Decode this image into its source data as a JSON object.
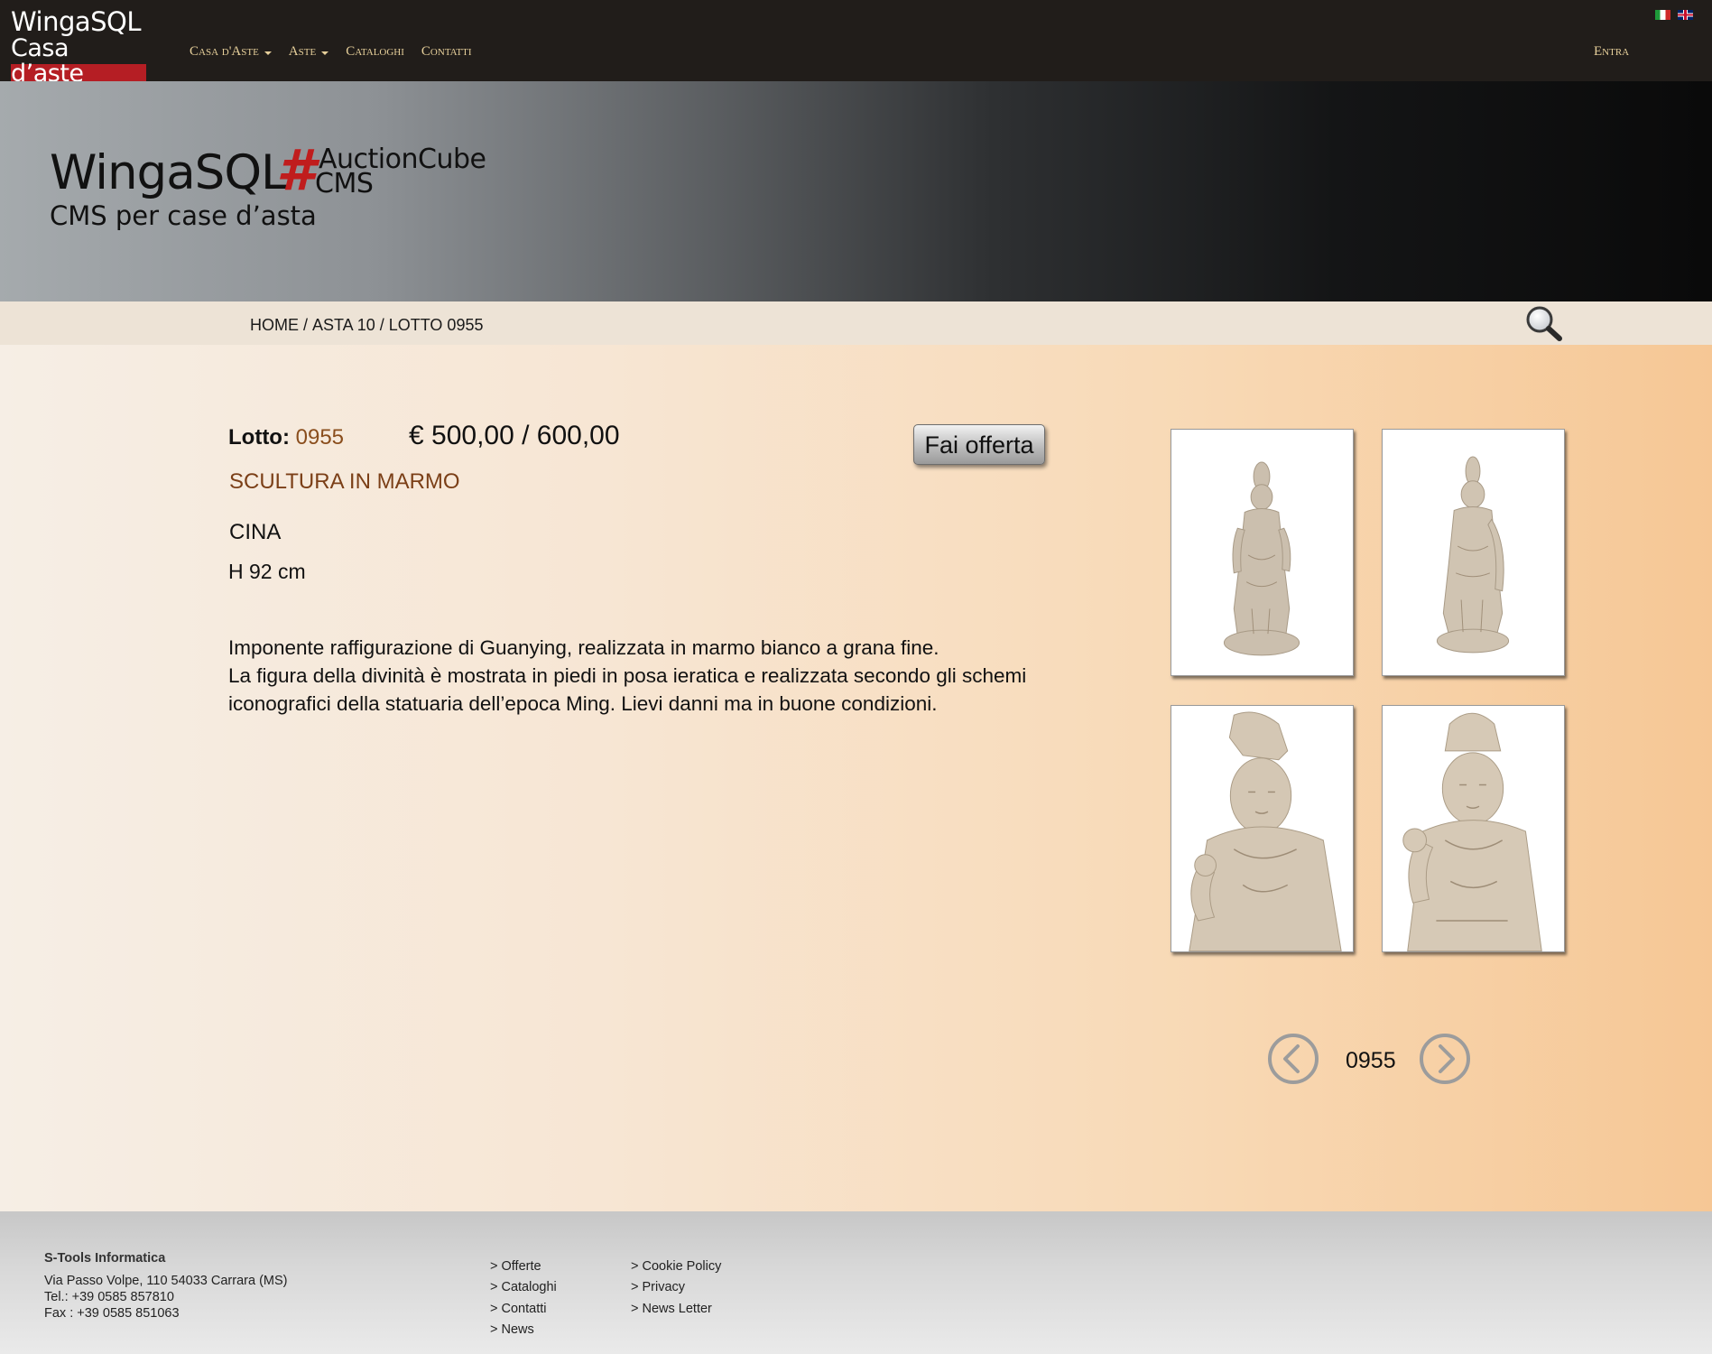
{
  "header": {
    "logo_line1": "WingaSQL",
    "logo_line2": "Casa d’aste",
    "nav": [
      {
        "label": "Casa d'Aste",
        "dropdown": true
      },
      {
        "label": "Aste",
        "dropdown": true
      },
      {
        "label": "Cataloghi",
        "dropdown": false
      },
      {
        "label": "Contatti",
        "dropdown": false
      }
    ],
    "login_label": "Entra",
    "flags": [
      "flag-it-icon",
      "flag-en-icon"
    ]
  },
  "banner": {
    "main": "WingaSQL",
    "hash": "#",
    "product_line1": "AuctionCube",
    "product_line2": "CMS",
    "subtitle": "CMS per case d’asta"
  },
  "breadcrumb": {
    "items": [
      "HOME",
      "ASTA 10",
      "LOTTO 0955"
    ],
    "separator": "/",
    "search_icon": "magnifier-icon"
  },
  "lot": {
    "label": "Lotto:",
    "number": "0955",
    "estimate": "€ 500,00 / 600,00",
    "bid_button": "Fai offerta",
    "title": "SCULTURA IN MARMO",
    "origin": "CINA",
    "dimensions": "H 92 cm",
    "description": [
      "Imponente raffigurazione di Guanying, realizzata in marmo bianco a grana fine.",
      "La figura della divinità è mostrata in piedi in posa ieratica e realizzata secondo gli schemi",
      "iconografici della statuaria dell’epoca Ming. Lievi danni ma in buone condizioni."
    ],
    "images": [
      "statue-front-full",
      "statue-side-full",
      "statue-detail-left",
      "statue-detail-right"
    ]
  },
  "pager": {
    "current": "0955",
    "prev_icon": "chevron-left-circle-icon",
    "next_icon": "chevron-right-circle-icon"
  },
  "footer": {
    "company": "S-Tools Informatica",
    "address": "Via Passo Volpe, 110 54033 Carrara (MS)",
    "tel": "Tel.: +39 0585 857810",
    "fax": "Fax : +39 0585 851063",
    "links_col1": [
      "> Offerte",
      "> Cataloghi",
      "> Contatti",
      "> News"
    ],
    "links_col2": [
      "> Cookie Policy",
      "> Privacy",
      "> News Letter"
    ]
  },
  "colors": {
    "topbar": "#211d1a",
    "nav_text": "#e6cf9a",
    "brand_red": "#c01d1d",
    "lot_accent": "#8a4e1d"
  }
}
